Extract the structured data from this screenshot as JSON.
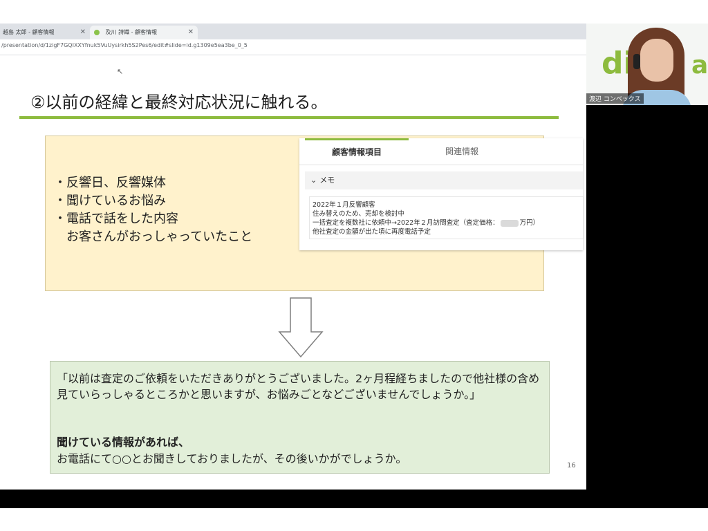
{
  "browser": {
    "tabs": [
      {
        "label": "越島 太郎 - 顧客情報"
      },
      {
        "label": "及川 詩織 - 顧客情報"
      }
    ],
    "url": "/presentation/d/1zigF7GQIXXYfnuk5VuUysirkh5S2Pes6/edit#slide=id.g1309e5ea3be_0_5"
  },
  "slide": {
    "title": "②以前の経緯と最終対応状況に触れる。",
    "bullets": [
      "・反響日、反響媒体",
      "・聞けているお悩み",
      "・電話で話をした内容",
      "　お客さんがおっしゃっていたこと"
    ],
    "crm": {
      "tab_active": "顧客情報項目",
      "tab_inactive": "関連情報",
      "memo_label": "メモ",
      "memo_lines": [
        "2022年１月反響顧客",
        "住み替えのため、売却を検討中",
        "一括査定を複数社に依頼中→2022年２月訪問査定（査定価格：",
        "他社査定の金額が出た頃に再度電話予定"
      ],
      "memo_line3_suffix": "万円）"
    },
    "quote": "「以前は査定のご依頼をいただきありがとうございました。2ヶ月程経ちましたので他社様の含め見ていらっしゃるところかと思いますが、お悩みごとなどございませんでしょうか。」",
    "subhead": "聞けている情報があれば、",
    "subtext": "お電話にて○○とお聞きしておりましたが、その後いかがでしょうか。",
    "page_number": "16"
  },
  "webcam": {
    "participant_name": "渡辺 コンベックス",
    "logo_text": "di",
    "logo_text2": "a"
  },
  "colors": {
    "accent_green": "#8dbb3e",
    "yellow_box": "#fff2cc",
    "green_box": "#e2efd9"
  }
}
